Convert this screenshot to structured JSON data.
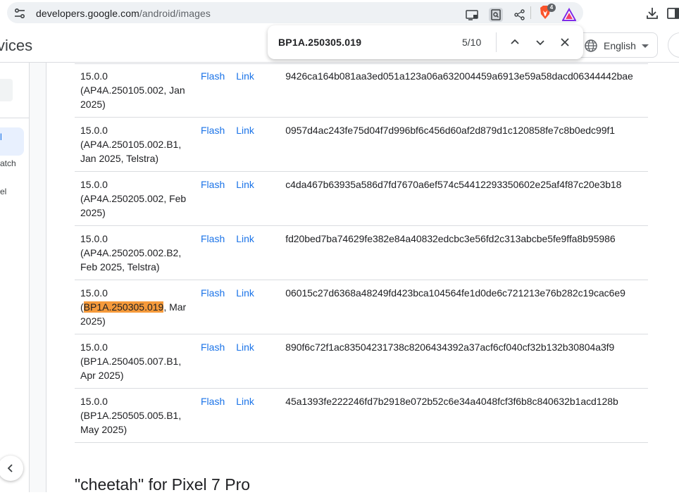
{
  "browser": {
    "url_host": "developers.google.com",
    "url_path": "/android/images",
    "brave_badge": "4",
    "icons": [
      "tune-icon",
      "cast-icon",
      "find-in-page-icon",
      "share-icon",
      "brave-shield-icon",
      "brave-rewards-icon",
      "download-icon",
      "sidebar-icon"
    ]
  },
  "site": {
    "name_fragment": "vices",
    "language": "English"
  },
  "find": {
    "query": "BP1A.250305.019",
    "count": "5/10"
  },
  "sidebar": {
    "active_fragment": "l",
    "item1": "atch",
    "item2": "el"
  },
  "table": {
    "rows": [
      {
        "v1": "15.0.0",
        "v2": "(AP4A.250105.002, Jan",
        "v3": "2025)",
        "flash": "Flash",
        "link": "Link",
        "hash": "9426ca164b081aa3ed051a123a06a632004459a6913e59a58dacd06344442bae"
      },
      {
        "v1": "15.0.0",
        "v2": "(AP4A.250105.002.B1,",
        "v3": "Jan 2025, Telstra)",
        "flash": "Flash",
        "link": "Link",
        "hash": "0957d4ac243fe75d04f7d996bf6c456d60af2d879d1c120858fe7c8b0edc99f1"
      },
      {
        "v1": "15.0.0",
        "v2": "(AP4A.250205.002, Feb",
        "v3": "2025)",
        "flash": "Flash",
        "link": "Link",
        "hash": "c4da467b63935a586d7fd7670a6ef574c54412293350602e25af4f87c20e3b18"
      },
      {
        "v1": "15.0.0",
        "v2": "(AP4A.250205.002.B2,",
        "v3": "Feb 2025, Telstra)",
        "flash": "Flash",
        "link": "Link",
        "hash": "fd20bed7ba74629fe382e84a40832edcbc3e56fd2c313abcbe5fe9ffa8b95986"
      },
      {
        "v1": "15.0.0",
        "v2_pre": "(",
        "v2_match": "BP1A.250305.019",
        "v2_post": ", Mar",
        "v3": "2025)",
        "flash": "Flash",
        "link": "Link",
        "hash": "06015c27d6368a48249fd423bca104564fe1d0de6c721213e76b282c19cac6e9"
      },
      {
        "v1": "15.0.0",
        "v2": "(BP1A.250405.007.B1,",
        "v3": "Apr 2025)",
        "flash": "Flash",
        "link": "Link",
        "hash": "890f6c72f1ac83504231738c8206434392a37acf6cf040cf32b132b30804a3f9"
      },
      {
        "v1": "15.0.0",
        "v2": "(BP1A.250505.005.B1,",
        "v3": "May 2025)",
        "flash": "Flash",
        "link": "Link",
        "hash": "45a1393fe222246fd7b2918e072b52c6e34a4048fcf3f6b8c840632b1acd128b"
      }
    ]
  },
  "section_heading": "\"cheetah\" for Pixel 7 Pro",
  "colors": {
    "link": "#1a73e8",
    "highlight": "#f59a3b"
  }
}
